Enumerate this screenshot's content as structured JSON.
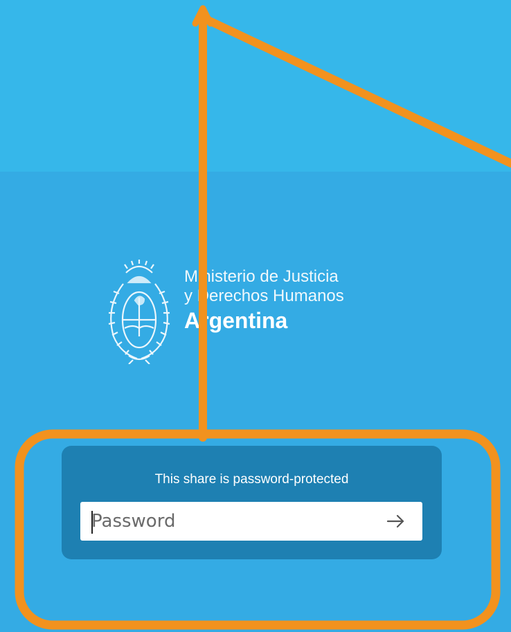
{
  "ministry": {
    "line1": "Ministerio de Justicia",
    "line2": "y Derechos Humanos",
    "line3": "Argentina"
  },
  "share": {
    "title": "This share is password-protected",
    "password_placeholder": "Password",
    "submit_icon": "arrow-right-icon"
  },
  "colors": {
    "background_top": "#36b7ea",
    "background_main": "#34abe4",
    "card": "#1e80b2",
    "annotation": "#f2921e"
  }
}
